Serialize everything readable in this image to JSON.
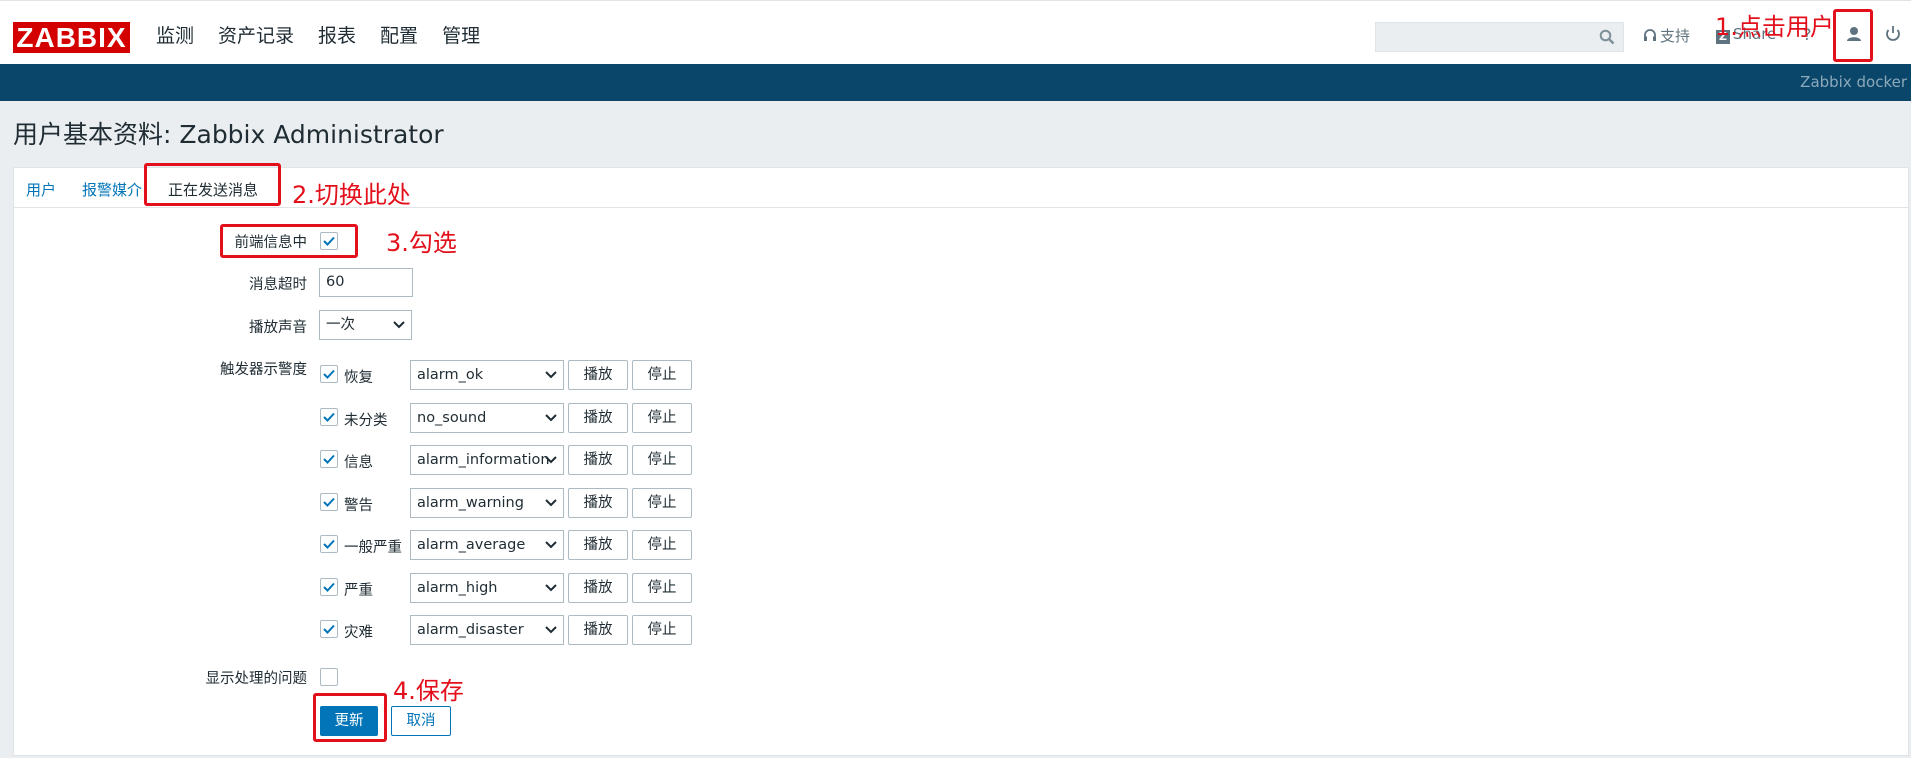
{
  "header": {
    "logo_text": "ZABBIX",
    "menu": [
      "监测",
      "资产记录",
      "报表",
      "配置",
      "管理"
    ],
    "search_value": "",
    "support_label": "支持",
    "share_label": "Share",
    "help_label": "?"
  },
  "strip": {
    "server_name": "Zabbix docker"
  },
  "page": {
    "title": "用户基本资料: Zabbix Administrator"
  },
  "tabs": [
    "用户",
    "报警媒介",
    "正在发送消息"
  ],
  "form": {
    "frontend_messaging_label": "前端信息中",
    "frontend_messaging_checked": true,
    "timeout_label": "消息超时",
    "timeout_value": "60",
    "play_sound_label": "播放声音",
    "play_sound_value": "一次",
    "severity_label": "触发器示警度",
    "severities": [
      {
        "name": "恢复",
        "checked": true,
        "sound": "alarm_ok"
      },
      {
        "name": "未分类",
        "checked": true,
        "sound": "no_sound"
      },
      {
        "name": "信息",
        "checked": true,
        "sound": "alarm_information"
      },
      {
        "name": "警告",
        "checked": true,
        "sound": "alarm_warning"
      },
      {
        "name": "一般严重",
        "checked": true,
        "sound": "alarm_average"
      },
      {
        "name": "严重",
        "checked": true,
        "sound": "alarm_high"
      },
      {
        "name": "灾难",
        "checked": true,
        "sound": "alarm_disaster"
      }
    ],
    "play_button": "播放",
    "stop_button": "停止",
    "show_suppressed_label": "显示处理的问题",
    "show_suppressed_checked": false,
    "update_button": "更新",
    "cancel_button": "取消"
  },
  "annotations": {
    "step1": "1.点击用户",
    "step2": "2.切换此处",
    "step3": "3.勾选",
    "step4": "4.保存"
  },
  "colors": {
    "brand": "#d40000",
    "strip": "#0a466a",
    "link": "#0275b8",
    "annotation": "#e3101b"
  }
}
